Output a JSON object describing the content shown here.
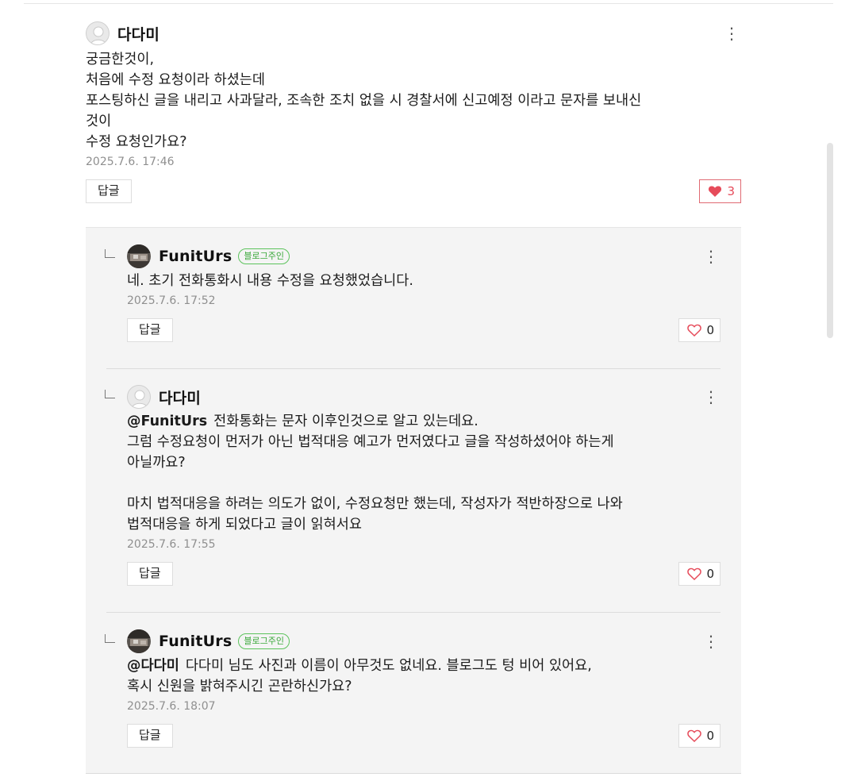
{
  "comment": {
    "author": "다다미",
    "text": "궁금한것이,\n처음에 수정 요청이라 하셨는데\n포스팅하신 글을 내리고 사과달라, 조속한 조치 없을 시 경찰서에 신고예정 이라고 문자를 보내신\n것이\n수정 요청인가요?",
    "date": "2025.7.6. 17:46",
    "reply_label": "답글",
    "like_count": "3",
    "more_icon": "⋮"
  },
  "replies": [
    {
      "author": "FunitUrs",
      "badge": "블로그주인",
      "mention": "",
      "text": "네. 초기 전화통화시 내용 수정을 요청했었습니다.",
      "date": "2025.7.6. 17:52",
      "reply_label": "답글",
      "like_count": "0",
      "more_icon": "⋮"
    },
    {
      "author": "다다미",
      "badge": "",
      "mention": "@FunitUrs",
      "text": "전화통화는 문자 이후인것으로 알고 있는데요.\n그럼 수정요청이 먼저가 아닌 법적대응 예고가 먼저였다고 글을 작성하셨어야 하는게\n아닐까요?\n\n마치 법적대응을 하려는 의도가 없이, 수정요청만 했는데, 작성자가 적반하장으로 나와\n법적대응을 하게 되었다고 글이 읽혀서요",
      "date": "2025.7.6. 17:55",
      "reply_label": "답글",
      "like_count": "0",
      "more_icon": "⋮"
    },
    {
      "author": "FunitUrs",
      "badge": "블로그주인",
      "mention": "@다다미",
      "text": "다다미 님도 사진과 이름이 아무것도 없네요. 블로그도 텅 비어 있어요,\n혹시 신원을 밝혀주시긴 곤란하신가요?",
      "date": "2025.7.6. 18:07",
      "reply_label": "답글",
      "like_count": "0",
      "more_icon": "⋮"
    }
  ],
  "colors": {
    "badge": "#3aa83a",
    "heart_active": "#e64b5a",
    "date": "#8f8f8f",
    "reply_area_bg": "#f4f4f4"
  }
}
